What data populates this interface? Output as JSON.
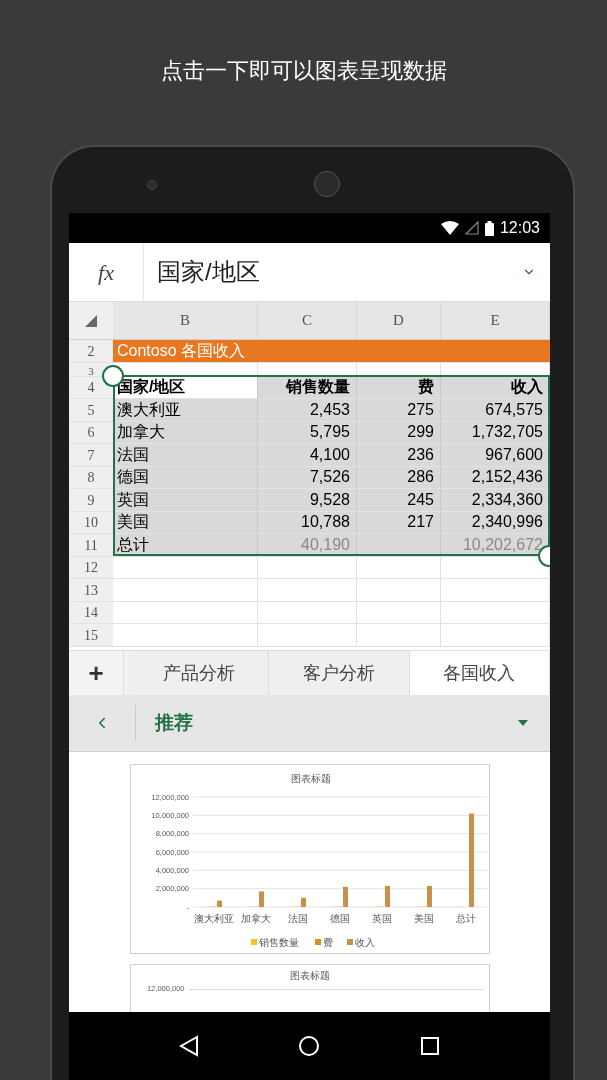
{
  "headline": "点击一下即可以图表呈现数据",
  "status_bar": {
    "time": "12:03"
  },
  "formula_bar": {
    "fx": "fx",
    "value": "国家/地区"
  },
  "sheet": {
    "columns": [
      "B",
      "C",
      "D",
      "E"
    ],
    "rows": [
      {
        "number": "2",
        "kind": "title",
        "cells": [
          "Contoso 各国收入"
        ]
      },
      {
        "number": "3",
        "kind": "spacer"
      },
      {
        "number": "4",
        "kind": "header",
        "cells": [
          "国家/地区",
          "销售数量",
          "费",
          "收入"
        ]
      },
      {
        "number": "5",
        "kind": "data",
        "cells": [
          "澳大利亚",
          "2,453",
          "275",
          "674,575"
        ]
      },
      {
        "number": "6",
        "kind": "data",
        "cells": [
          "加拿大",
          "5,795",
          "299",
          "1,732,705"
        ]
      },
      {
        "number": "7",
        "kind": "data",
        "cells": [
          "法国",
          "4,100",
          "236",
          "967,600"
        ]
      },
      {
        "number": "8",
        "kind": "data",
        "cells": [
          "德国",
          "7,526",
          "286",
          "2,152,436"
        ]
      },
      {
        "number": "9",
        "kind": "data",
        "cells": [
          "英国",
          "9,528",
          "245",
          "2,334,360"
        ]
      },
      {
        "number": "10",
        "kind": "data",
        "cells": [
          "美国",
          "10,788",
          "217",
          "2,340,996"
        ]
      },
      {
        "number": "11",
        "kind": "total",
        "cells": [
          "总计",
          "40,190",
          "",
          "10,202,672"
        ]
      },
      {
        "number": "12",
        "kind": "blank"
      },
      {
        "number": "13",
        "kind": "blank"
      },
      {
        "number": "14",
        "kind": "blank"
      },
      {
        "number": "15",
        "kind": "blank"
      }
    ]
  },
  "sheet_tabs": {
    "add": "+",
    "tabs": [
      {
        "label": "产品分析",
        "selected": false
      },
      {
        "label": "客户分析",
        "selected": false
      },
      {
        "label": "各国收入",
        "selected": true
      }
    ]
  },
  "recommend_bar": {
    "title": "推荐"
  },
  "charts": [
    {
      "chart_data": {
        "type": "bar",
        "title": "图表标题",
        "categories": [
          "澳大利亚",
          "加拿大",
          "法国",
          "德国",
          "英国",
          "美国",
          "总计"
        ],
        "series": [
          {
            "name": "销售数量",
            "color": "#f2c12e",
            "values": [
              0,
              0,
              0,
              0,
              0,
              0,
              0
            ]
          },
          {
            "name": "费",
            "color": "#e0892b",
            "values": [
              0,
              0,
              0,
              0,
              0,
              0,
              null
            ]
          },
          {
            "name": "收入",
            "color": "#c8914a",
            "values": [
              700000,
              1700000,
              1000000,
              2200000,
              2300000,
              2300000,
              10200000
            ]
          }
        ],
        "grid": true,
        "legend": true,
        "ylim": [
          0,
          12000000
        ],
        "yticks": [
          {
            "value": 0,
            "label": "-"
          },
          {
            "value": 2000000,
            "label": "2,000,000"
          },
          {
            "value": 4000000,
            "label": "4,000,000"
          },
          {
            "value": 6000000,
            "label": "6,000,000"
          },
          {
            "value": 8000000,
            "label": "8,000,000"
          },
          {
            "value": 10000000,
            "label": "10,000,000"
          },
          {
            "value": 12000000,
            "label": "12,000,000"
          }
        ]
      }
    },
    {
      "title": "图表标题",
      "ytick_labels": [
        "12,000,000"
      ]
    }
  ]
}
